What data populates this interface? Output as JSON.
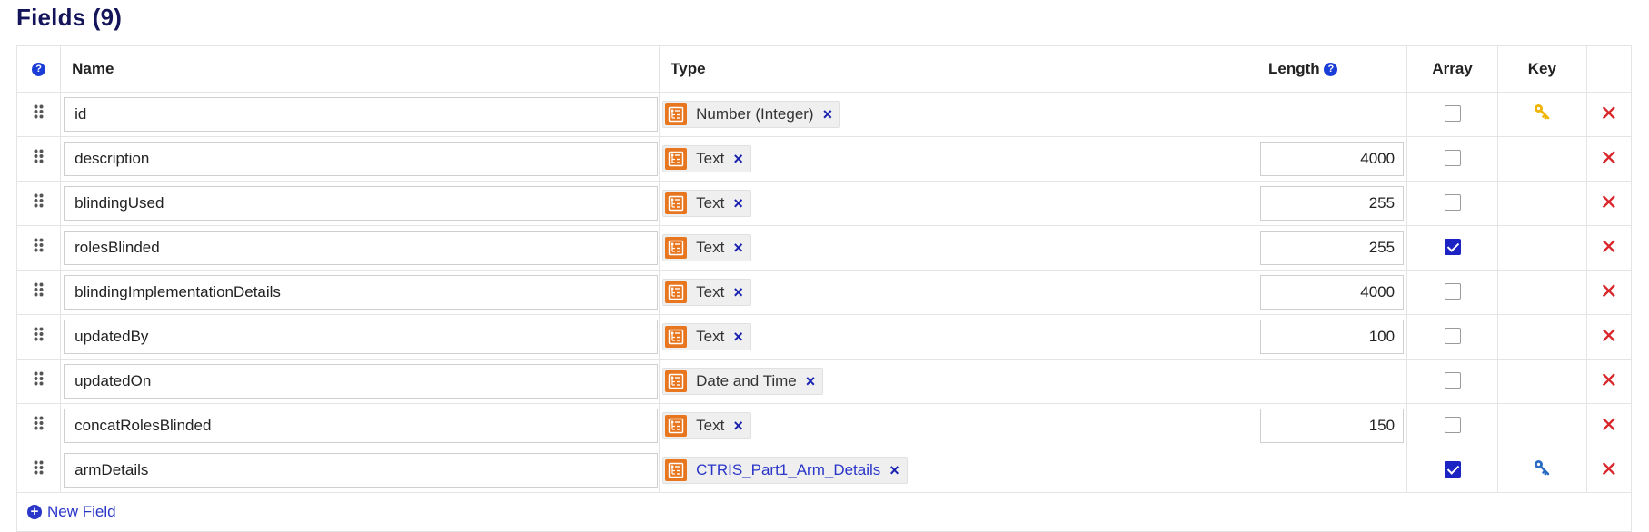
{
  "title": {
    "label": "Fields",
    "count": "(9)"
  },
  "columns": {
    "help": "?",
    "name": "Name",
    "type": "Type",
    "length": "Length",
    "array": "Array",
    "key": "Key"
  },
  "icons": {
    "drag": "drag-handle-icon",
    "type": "field-type-icon",
    "remove_type": "×",
    "delete": "✕",
    "primary_key": "key-icon",
    "foreign_key": "foreign-key-icon"
  },
  "colors": {
    "accent": "#1b23c2",
    "type_icon": "#e8761f",
    "delete": "#d8262b",
    "primary_key": "#f0b400",
    "foreign_key": "#2a6cc4",
    "title": "#14145a"
  },
  "fields": [
    {
      "name": "id",
      "type": "Number (Integer)",
      "type_link": false,
      "length": "",
      "array": false,
      "key": "primary"
    },
    {
      "name": "description",
      "type": "Text",
      "type_link": false,
      "length": "4000",
      "array": false,
      "key": ""
    },
    {
      "name": "blindingUsed",
      "type": "Text",
      "type_link": false,
      "length": "255",
      "array": false,
      "key": ""
    },
    {
      "name": "rolesBlinded",
      "type": "Text",
      "type_link": false,
      "length": "255",
      "array": true,
      "key": ""
    },
    {
      "name": "blindingImplementationDetails",
      "type": "Text",
      "type_link": false,
      "length": "4000",
      "array": false,
      "key": ""
    },
    {
      "name": "updatedBy",
      "type": "Text",
      "type_link": false,
      "length": "100",
      "array": false,
      "key": ""
    },
    {
      "name": "updatedOn",
      "type": "Date and Time",
      "type_link": false,
      "length": "",
      "array": false,
      "key": ""
    },
    {
      "name": "concatRolesBlinded",
      "type": "Text",
      "type_link": false,
      "length": "150",
      "array": false,
      "key": ""
    },
    {
      "name": "armDetails",
      "type": "CTRIS_Part1_Arm_Details",
      "type_link": true,
      "length": "",
      "array": true,
      "key": "foreign"
    }
  ],
  "new_field": {
    "label": "New Field",
    "icon": "+"
  }
}
